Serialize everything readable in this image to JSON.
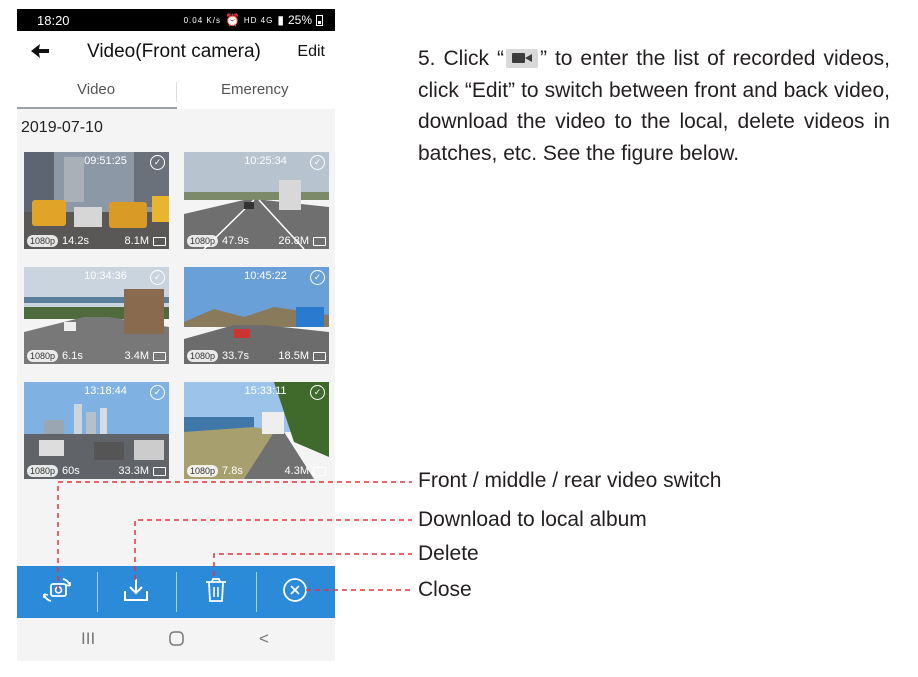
{
  "status_bar": {
    "time": "18:20",
    "speed": "0.04 K/s",
    "network": "HD 4G",
    "battery": "25%"
  },
  "nav": {
    "title": "Video(Front camera)",
    "edit": "Edit",
    "back_icon": "back-arrow-icon"
  },
  "tabs": [
    {
      "label": "Video",
      "selected": true
    },
    {
      "label": "Emerency",
      "selected": false
    }
  ],
  "date": "2019-07-10",
  "videos": [
    {
      "time": "09:51:25",
      "resolution": "1080p",
      "duration": "14.2s",
      "size": "8.1M"
    },
    {
      "time": "10:25:34",
      "resolution": "1080p",
      "duration": "47.9s",
      "size": "26.8M"
    },
    {
      "time": "10:34:36",
      "resolution": "1080p",
      "duration": "6.1s",
      "size": "3.4M"
    },
    {
      "time": "10:45:22",
      "resolution": "1080p",
      "duration": "33.7s",
      "size": "18.5M"
    },
    {
      "time": "13:18:44",
      "resolution": "1080p",
      "duration": "60s",
      "size": "33.3M"
    },
    {
      "time": "15:33:11",
      "resolution": "1080p",
      "duration": "7.8s",
      "size": "4.3M"
    }
  ],
  "toolbar": {
    "color": "#2b8bd8",
    "buttons": [
      "camera-switch-icon",
      "download-icon",
      "trash-icon",
      "close-circle-icon"
    ]
  },
  "system_nav": {
    "recents": "III",
    "home": "home-icon",
    "back": "<"
  },
  "description": {
    "before_icon": "5. Click “",
    "after_icon": "” to enter the list of recorded videos, click “Edit” to switch between front and back video, download the video to the local, delete videos in batches, etc. See the figure below."
  },
  "callouts": [
    "Front / middle / rear video switch",
    "Download to local album",
    "Delete",
    "Close"
  ],
  "callout_color": "#e8323c"
}
